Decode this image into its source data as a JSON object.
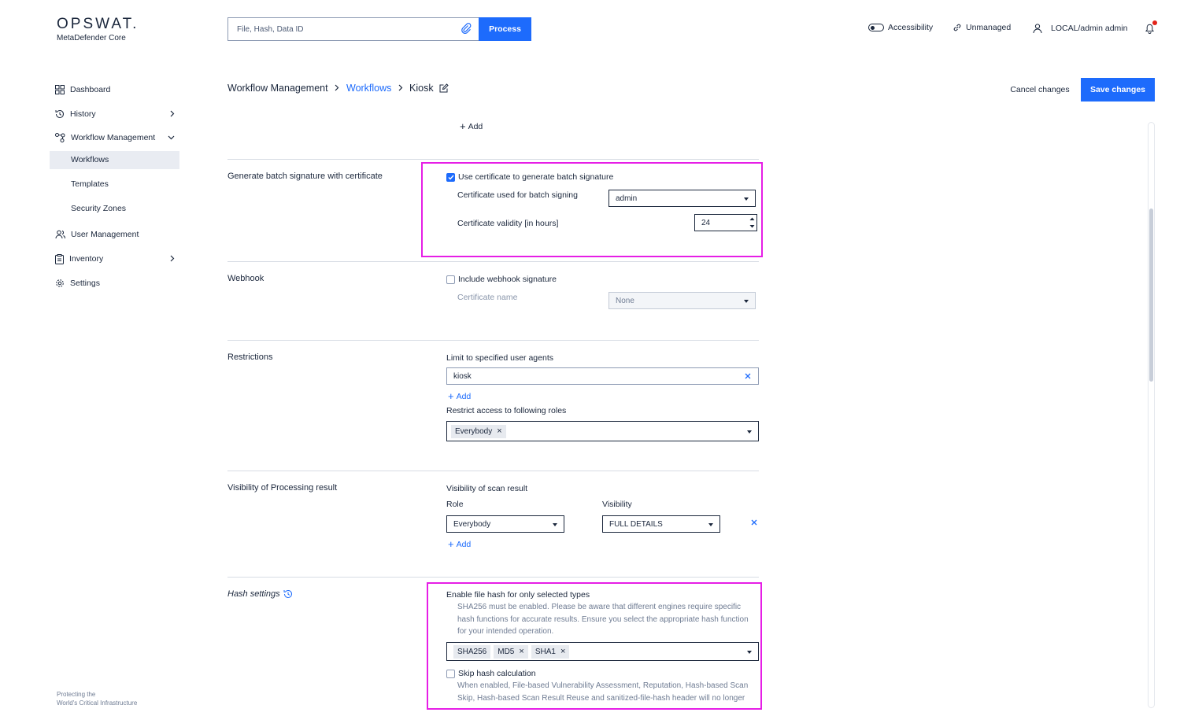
{
  "brand": {
    "logo": "OPSWAT.",
    "product": "MetaDefender Core",
    "tagline_line1": "Protecting the",
    "tagline_line2": "World's Critical Infrastructure"
  },
  "search": {
    "placeholder": "File, Hash, Data ID",
    "button": "Process"
  },
  "topbar": {
    "accessibility": "Accessibility",
    "unmanaged": "Unmanaged",
    "user": "LOCAL/admin admin"
  },
  "sidebar": {
    "items": [
      {
        "label": "Dashboard",
        "icon": "grid-icon"
      },
      {
        "label": "History",
        "icon": "history-icon"
      },
      {
        "label": "Workflow Management",
        "icon": "workflow-icon"
      },
      {
        "label": "User Management",
        "icon": "users-icon"
      },
      {
        "label": "Inventory",
        "icon": "clipboard-icon"
      },
      {
        "label": "Settings",
        "icon": "gear-icon"
      }
    ],
    "subitems": [
      "Workflows",
      "Templates",
      "Security Zones"
    ]
  },
  "breadcrumb": {
    "root": "Workflow Management",
    "parent": "Workflows",
    "current": "Kiosk"
  },
  "actions": {
    "cancel": "Cancel changes",
    "save": "Save changes"
  },
  "top_add": "Add",
  "batch": {
    "title": "Generate batch signature with certificate",
    "checkbox": "Use certificate to generate batch signature",
    "checked": true,
    "cert_label": "Certificate used for batch signing",
    "cert_value": "admin",
    "validity_label": "Certificate validity [in hours]",
    "validity_value": "24"
  },
  "webhook": {
    "title": "Webhook",
    "checkbox": "Include webhook signature",
    "checked": false,
    "cert_label": "Certificate name",
    "cert_value": "None"
  },
  "restrictions": {
    "title": "Restrictions",
    "agents_label": "Limit to specified user agents",
    "agent_value": "kiosk",
    "add": "Add",
    "roles_label": "Restrict access to following roles",
    "roles": [
      "Everybody"
    ]
  },
  "visibility": {
    "title": "Visibility of Processing result",
    "scan_label": "Visibility of scan result",
    "role_label": "Role",
    "visibility_label": "Visibility",
    "role_value": "Everybody",
    "visibility_value": "FULL DETAILS",
    "add": "Add"
  },
  "hash": {
    "title": "Hash settings",
    "enable_label": "Enable file hash for only selected types",
    "enable_help_1": "SHA256 must be enabled. Please be aware that different engines require specific",
    "enable_help_2": "hash functions for accurate results. Ensure you select the appropriate hash function",
    "enable_help_3": "for your intended operation.",
    "types": [
      "SHA256",
      "MD5",
      "SHA1"
    ],
    "skip_label": "Skip hash calculation",
    "skip_checked": false,
    "skip_help_1": "When enabled, File-based Vulnerability Assessment, Reputation, Hash-based Scan",
    "skip_help_2": "Skip, Hash-based Scan Result Reuse and sanitized-file-hash header will no longer"
  },
  "colors": {
    "accent": "#1d6bfc",
    "highlight": "#e61ee6",
    "text": "#1b273c"
  }
}
